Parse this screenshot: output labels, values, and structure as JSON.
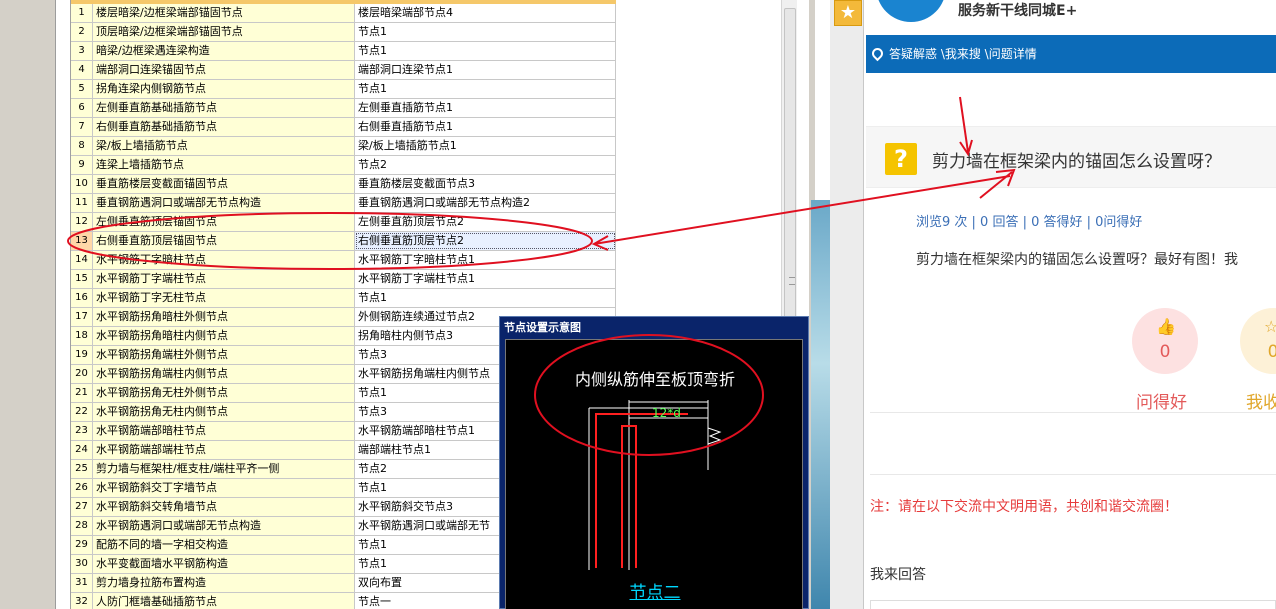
{
  "grid": {
    "rows": [
      {
        "num": "1",
        "name": "楼层暗梁/边框梁端部锚固节点",
        "value": "楼层暗梁端部节点4"
      },
      {
        "num": "2",
        "name": "顶层暗梁/边框梁端部锚固节点",
        "value": "节点1"
      },
      {
        "num": "3",
        "name": "暗梁/边框梁遇连梁构造",
        "value": "节点1"
      },
      {
        "num": "4",
        "name": "端部洞口连梁锚固节点",
        "value": "端部洞口连梁节点1"
      },
      {
        "num": "5",
        "name": "拐角连梁内侧钢筋节点",
        "value": "节点1"
      },
      {
        "num": "6",
        "name": "左侧垂直筋基础插筋节点",
        "value": "左侧垂直插筋节点1"
      },
      {
        "num": "7",
        "name": "右侧垂直筋基础插筋节点",
        "value": "右侧垂直插筋节点1"
      },
      {
        "num": "8",
        "name": "梁/板上墙插筋节点",
        "value": "梁/板上墙插筋节点1"
      },
      {
        "num": "9",
        "name": "连梁上墙插筋节点",
        "value": "节点2"
      },
      {
        "num": "10",
        "name": "垂直筋楼层变截面锚固节点",
        "value": "垂直筋楼层变截面节点3"
      },
      {
        "num": "11",
        "name": "垂直钢筋遇洞口或端部无节点构造",
        "value": "垂直钢筋遇洞口或端部无节点构造2"
      },
      {
        "num": "12",
        "name": "左侧垂直筋顶层锚固节点",
        "value": "左侧垂直筋顶层节点2"
      },
      {
        "num": "13",
        "name": "右侧垂直筋顶层锚固节点",
        "value": "右侧垂直筋顶层节点2"
      },
      {
        "num": "14",
        "name": "水平钢筋丁字暗柱节点",
        "value": "水平钢筋丁字暗柱节点1"
      },
      {
        "num": "15",
        "name": "水平钢筋丁字端柱节点",
        "value": "水平钢筋丁字端柱节点1"
      },
      {
        "num": "16",
        "name": "水平钢筋丁字无柱节点",
        "value": "节点1"
      },
      {
        "num": "17",
        "name": "水平钢筋拐角暗柱外侧节点",
        "value": "外侧钢筋连续通过节点2"
      },
      {
        "num": "18",
        "name": "水平钢筋拐角暗柱内侧节点",
        "value": "拐角暗柱内侧节点3"
      },
      {
        "num": "19",
        "name": "水平钢筋拐角端柱外侧节点",
        "value": "节点3"
      },
      {
        "num": "20",
        "name": "水平钢筋拐角端柱内侧节点",
        "value": "水平钢筋拐角端柱内侧节点"
      },
      {
        "num": "21",
        "name": "水平钢筋拐角无柱外侧节点",
        "value": "节点1"
      },
      {
        "num": "22",
        "name": "水平钢筋拐角无柱内侧节点",
        "value": "节点3"
      },
      {
        "num": "23",
        "name": "水平钢筋端部暗柱节点",
        "value": "水平钢筋端部暗柱节点1"
      },
      {
        "num": "24",
        "name": "水平钢筋端部端柱节点",
        "value": "端部端柱节点1"
      },
      {
        "num": "25",
        "name": "剪力墙与框架柱/框支柱/端柱平齐一侧",
        "value": "节点2"
      },
      {
        "num": "26",
        "name": "水平钢筋斜交丁字墙节点",
        "value": "节点1"
      },
      {
        "num": "27",
        "name": "水平钢筋斜交转角墙节点",
        "value": "水平钢筋斜交节点3"
      },
      {
        "num": "28",
        "name": "水平钢筋遇洞口或端部无节点构造",
        "value": "水平钢筋遇洞口或端部无节"
      },
      {
        "num": "29",
        "name": "配筋不同的墙一字相交构造",
        "value": "节点1"
      },
      {
        "num": "30",
        "name": "水平变截面墙水平钢筋构造",
        "value": "节点1"
      },
      {
        "num": "31",
        "name": "剪力墙身拉筋布置构造",
        "value": "双向布置"
      },
      {
        "num": "32",
        "name": "人防门框墙基础插筋节点",
        "value": "节点一"
      }
    ],
    "selected_row": "13"
  },
  "popup": {
    "title": "节点设置示意图",
    "caption": "内侧纵筋伸至板顶弯折",
    "dimension": "12*d",
    "node_label": "节点二"
  },
  "web": {
    "brand": "服务新干线同城E+",
    "breadcrumb": "答疑解惑 \\我来搜 \\问题详情",
    "question_icon": "?",
    "question_title": "剪力墙在框架梁内的锚固怎么设置呀？",
    "stats": "浏览9 次 | 0 回答 | 0 答得好 | 0问得好",
    "question_body": "剪力墙在框架梁内的锚固怎么设置呀？最好有图！我",
    "like_count": "0",
    "like_label": "问得好",
    "fav_count": "0",
    "fav_label": "我收",
    "notice": "注：请在以下交流中文明用语，共创和谐交流圈！",
    "answer_label": "我来回答"
  },
  "colors": {
    "annotation": "#e01020",
    "nav_blue": "#0c6bb8",
    "grid_yellow": "#ffffd6"
  },
  "icons": {
    "star": "star-icon",
    "location": "location-pin-icon",
    "question": "question-mark-icon",
    "like": "thumbs-up-icon",
    "favorite": "star-outline-icon"
  }
}
